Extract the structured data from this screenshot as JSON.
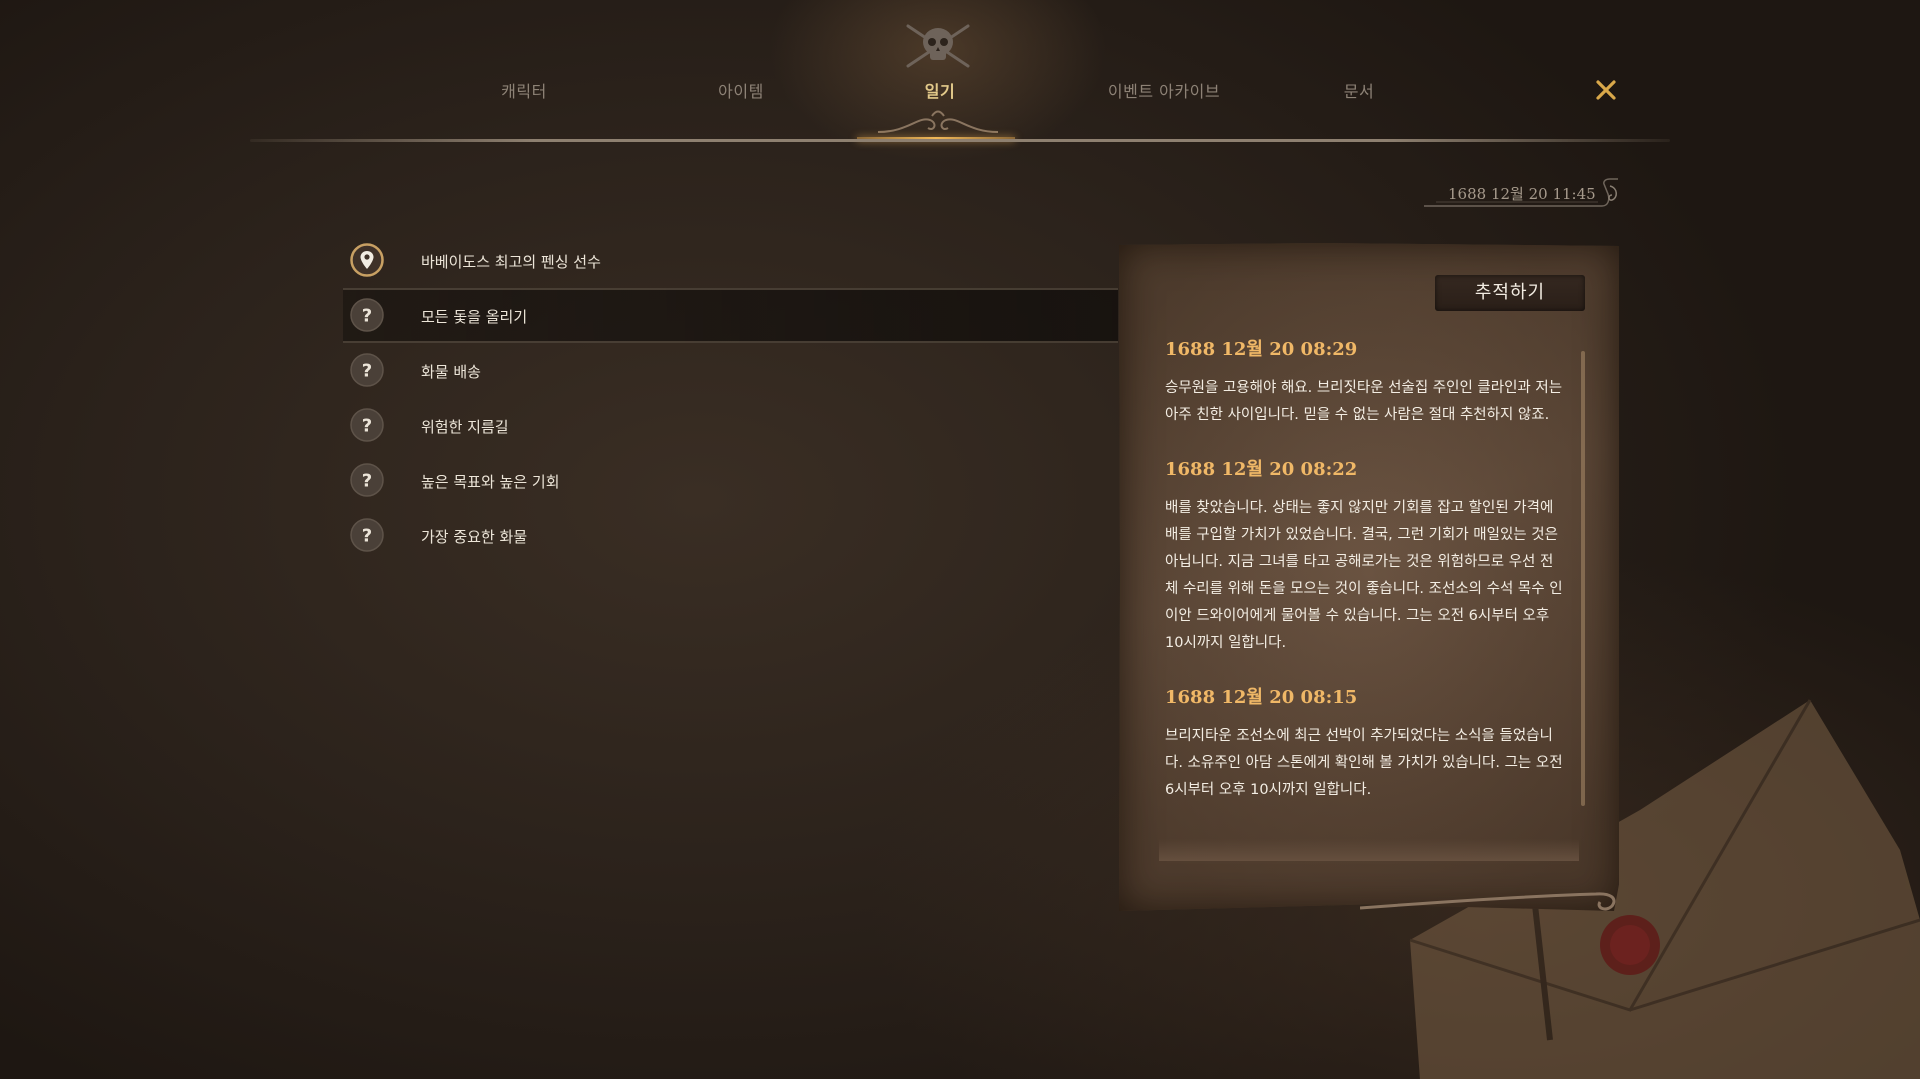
{
  "nav": {
    "tabs": [
      {
        "label": "캐릭터"
      },
      {
        "label": "아이템"
      },
      {
        "label": "일기"
      },
      {
        "label": "이벤트 아카이브"
      },
      {
        "label": "문서"
      }
    ],
    "active_tab": "일기",
    "emblem_icon": "skull-crossbones-icon",
    "close_icon": "close-x-icon"
  },
  "datetime": "1688 12월 20 11:45",
  "quests": [
    {
      "label": "바베이도스 최고의 펜싱 선수",
      "icon": "map-pin-icon",
      "state": "tracked"
    },
    {
      "label": "모든 돛을 올리기",
      "icon": "question-mark-icon",
      "state": "selected"
    },
    {
      "label": "화물 배송",
      "icon": "question-mark-icon"
    },
    {
      "label": "위험한 지름길",
      "icon": "question-mark-icon"
    },
    {
      "label": "높은 목표와 높은 기회",
      "icon": "question-mark-icon"
    },
    {
      "label": "가장 중요한 화물",
      "icon": "question-mark-icon"
    }
  ],
  "journal": {
    "track_button": "추적하기",
    "entries": [
      {
        "date": "1688 12월 20 08:29",
        "text": "승무원을 고용해야 해요. 브리짓타운 선술집 주인인 클라인과 저는 아주 친한 사이입니다. 믿을 수 없는 사람은 절대 추천하지 않죠."
      },
      {
        "date": "1688 12월 20 08:22",
        "text": "배를 찾았습니다. 상태는 좋지 않지만 기회를 잡고 할인된 가격에 배를 구입할 가치가 있었습니다. 결국, 그런 기회가 매일있는 것은 아닙니다. 지금 그녀를 타고 공해로가는 것은 위험하므로 우선 전체 수리를 위해 돈을 모으는 것이 좋습니다. 조선소의 수석 목수 인 이안 드와이어에게 물어볼 수 있습니다. 그는 오전 6시부터 오후 10시까지 일합니다."
      },
      {
        "date": "1688 12월 20 08:15",
        "text": "브리지타운 조선소에 최근 선박이 추가되었다는 소식을 들었습니다. 소유주인 아담 스톤에게 확인해 볼 가치가 있습니다. 그는 오전 6시부터 오후 10시까지 일합니다."
      }
    ]
  },
  "colors": {
    "accent_gold": "#f0b867",
    "tab_active": "#e2c98a",
    "tab_inactive": "#8d8276",
    "close_icon": "#d9a84a"
  }
}
